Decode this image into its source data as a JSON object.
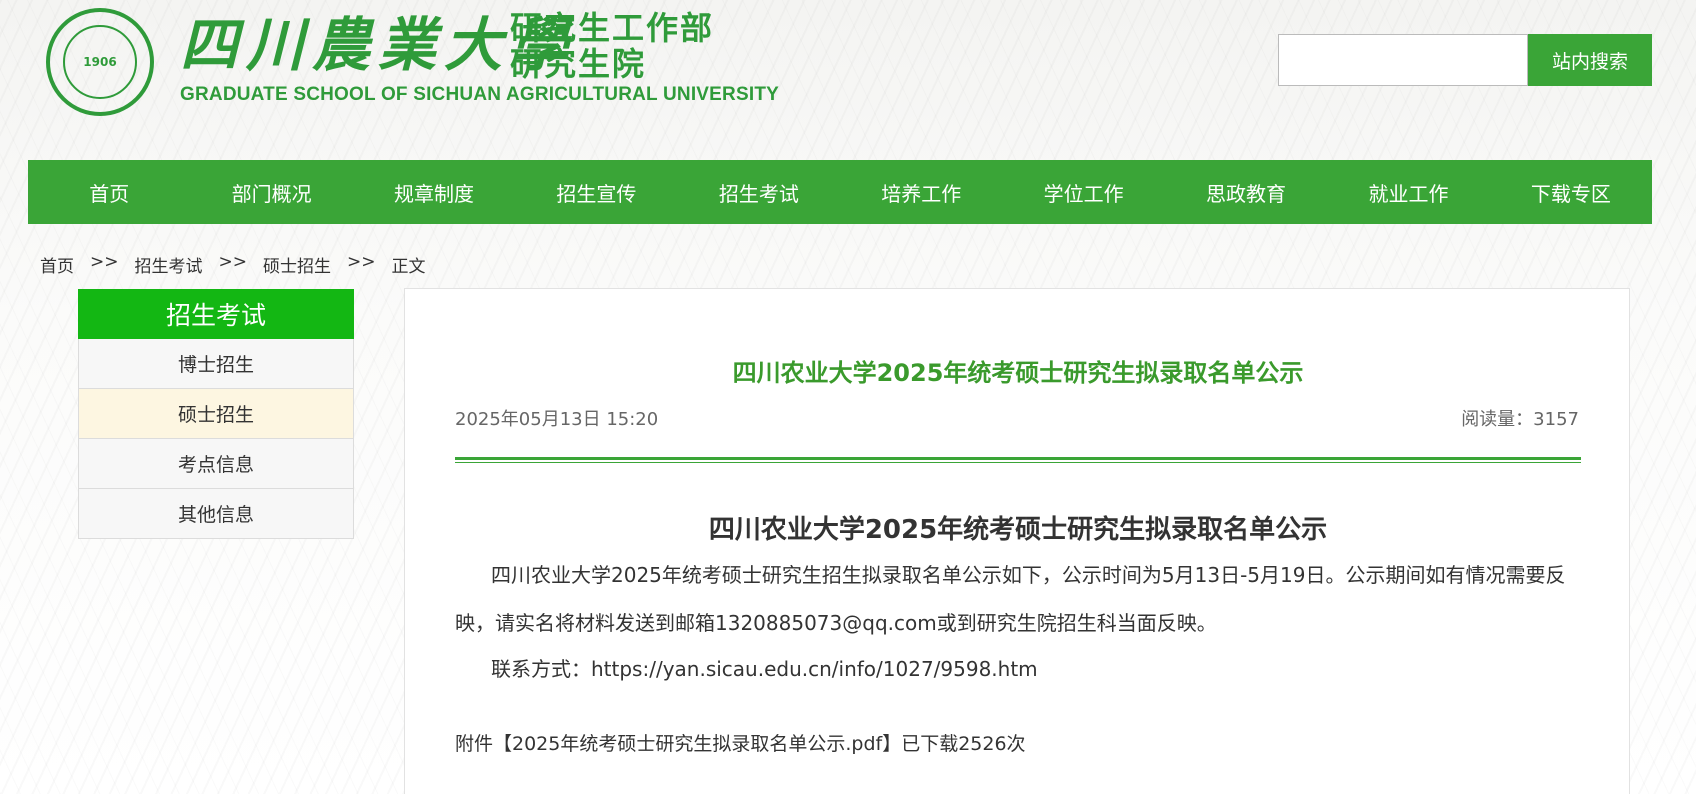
{
  "header": {
    "school_name_cn": "四川農業大學",
    "dept_line1": "研究生工作部",
    "dept_line2": "研究生院",
    "school_name_en": "GRADUATE SCHOOL OF SICHUAN AGRICULTURAL UNIVERSITY",
    "seal_text": "1906"
  },
  "search": {
    "placeholder": "",
    "button_label": "站内搜索"
  },
  "nav": {
    "items": [
      "首页",
      "部门概况",
      "规章制度",
      "招生宣传",
      "招生考试",
      "培养工作",
      "学位工作",
      "思政教育",
      "就业工作",
      "下载专区"
    ]
  },
  "breadcrumb": {
    "items": [
      "首页",
      ">>",
      "招生考试",
      ">>",
      "硕士招生",
      ">>",
      "正文"
    ]
  },
  "sidebar": {
    "title": "招生考试",
    "items": [
      {
        "label": "博士招生",
        "active": false
      },
      {
        "label": "硕士招生",
        "active": true
      },
      {
        "label": "考点信息",
        "active": false
      },
      {
        "label": "其他信息",
        "active": false
      }
    ]
  },
  "article": {
    "title": "四川农业大学2025年统考硕士研究生拟录取名单公示",
    "date": "2025年05月13日 15:20",
    "views": "阅读量：3157",
    "body_title": "四川农业大学2025年统考硕士研究生拟录取名单公示",
    "paragraph1": "四川农业大学2025年统考硕士研究生招生拟录取名单公示如下，公示时间为5月13日-5月19日。公示期间如有情况需要反映，请实名将材料发送到邮箱1320885073@qq.com或到研究生院招生科当面反映。",
    "paragraph2": "联系方式：https://yan.sicau.edu.cn/info/1027/9598.htm",
    "attachment": "附件【2025年统考硕士研究生拟录取名单公示.pdf】已下载2526次"
  },
  "colors": {
    "brand_green": "#3aa537",
    "sidebar_green": "#13b713",
    "active_bg": "#fdf6e1"
  }
}
